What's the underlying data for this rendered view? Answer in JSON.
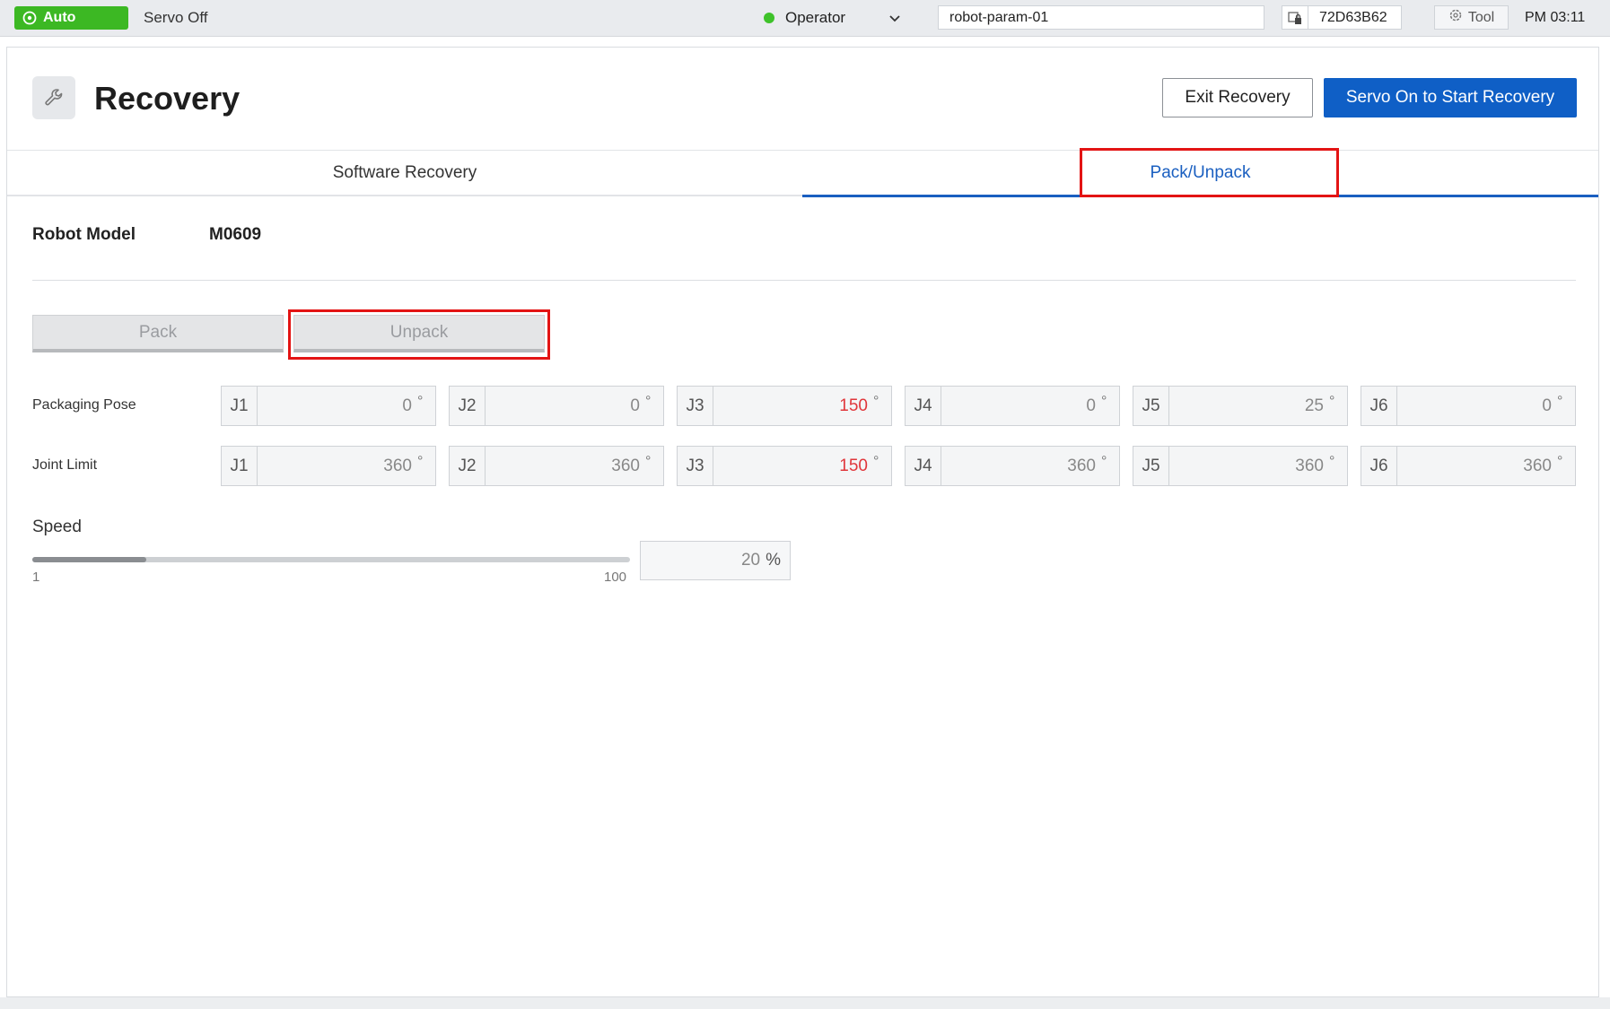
{
  "topbar": {
    "mode": "Auto",
    "servo_status": "Servo Off",
    "user_role": "Operator",
    "project_name": "robot-param-01",
    "device_id": "72D63B62",
    "tool_label": "Tool",
    "clock": "PM 03:11"
  },
  "header": {
    "title": "Recovery",
    "exit_label": "Exit Recovery",
    "start_label": "Servo On to Start Recovery"
  },
  "tabs": [
    {
      "label": "Software Recovery",
      "active": false
    },
    {
      "label": "Pack/Unpack",
      "active": true
    }
  ],
  "robot_model": {
    "label": "Robot Model",
    "value": "M0609"
  },
  "actions": {
    "pack_label": "Pack",
    "unpack_label": "Unpack"
  },
  "packaging_pose": {
    "label": "Packaging Pose",
    "joints": [
      {
        "name": "J1",
        "value": "0",
        "unit": "°"
      },
      {
        "name": "J2",
        "value": "0",
        "unit": "°"
      },
      {
        "name": "J3",
        "value": "150",
        "unit": "°"
      },
      {
        "name": "J4",
        "value": "0",
        "unit": "°"
      },
      {
        "name": "J5",
        "value": "25",
        "unit": "°"
      },
      {
        "name": "J6",
        "value": "0",
        "unit": "°"
      }
    ]
  },
  "joint_limit": {
    "label": "Joint Limit",
    "joints": [
      {
        "name": "J1",
        "value": "360",
        "unit": "°"
      },
      {
        "name": "J2",
        "value": "360",
        "unit": "°"
      },
      {
        "name": "J3",
        "value": "150",
        "unit": "°"
      },
      {
        "name": "J4",
        "value": "360",
        "unit": "°"
      },
      {
        "name": "J5",
        "value": "360",
        "unit": "°"
      },
      {
        "name": "J6",
        "value": "360",
        "unit": "°"
      }
    ]
  },
  "speed": {
    "label": "Speed",
    "min": "1",
    "max": "100",
    "value": "20",
    "unit": "%",
    "level": 0.19
  },
  "colors": {
    "accent": "#0f5fc6",
    "mode_green": "#3cb823",
    "warning_red": "#e0363b",
    "highlight_red": "#e31414"
  },
  "icons": {
    "mode": "robot-auto-icon",
    "user_status": "online-dot-icon",
    "user_menu": "chevron-down-icon",
    "device": "device-lock-icon",
    "tool": "gear-icon",
    "page": "wrench-icon"
  }
}
